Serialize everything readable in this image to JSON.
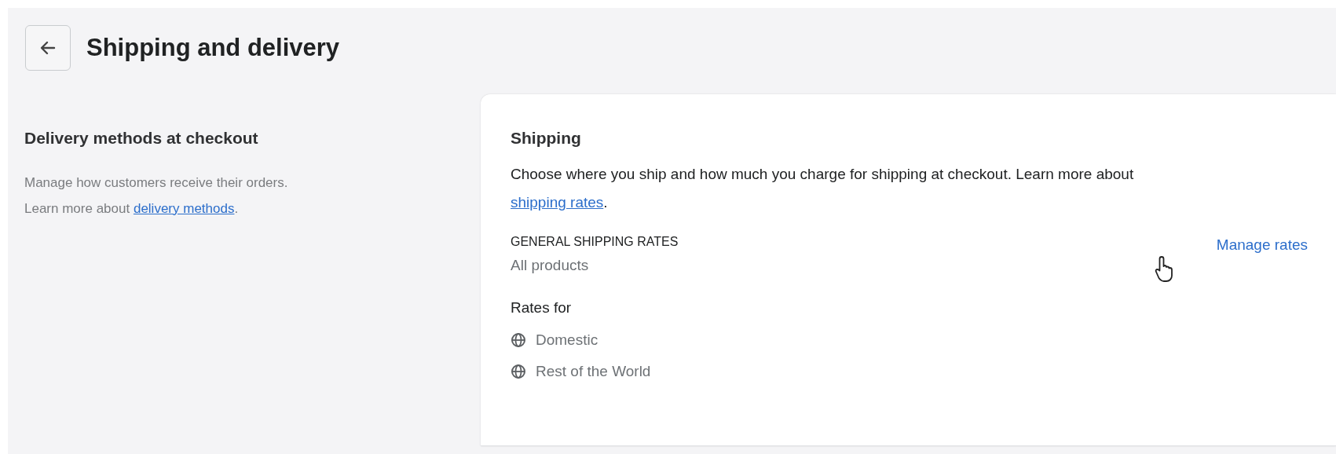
{
  "header": {
    "title": "Shipping and delivery"
  },
  "section": {
    "title": "Delivery methods at checkout",
    "description": "Manage how customers receive their orders.",
    "learn_prefix": "Learn more about ",
    "learn_link": "delivery methods",
    "learn_suffix": "."
  },
  "card": {
    "title": "Shipping",
    "description": "Choose where you ship and how much you charge for shipping at checkout. Learn more about ",
    "link": "shipping rates",
    "suffix": ".",
    "profile": {
      "title": "GENERAL SHIPPING RATES",
      "subtitle": "All products",
      "action": "Manage rates"
    },
    "rates_label": "Rates for",
    "zones": [
      {
        "name": "Domestic"
      },
      {
        "name": "Rest of the World"
      }
    ]
  }
}
